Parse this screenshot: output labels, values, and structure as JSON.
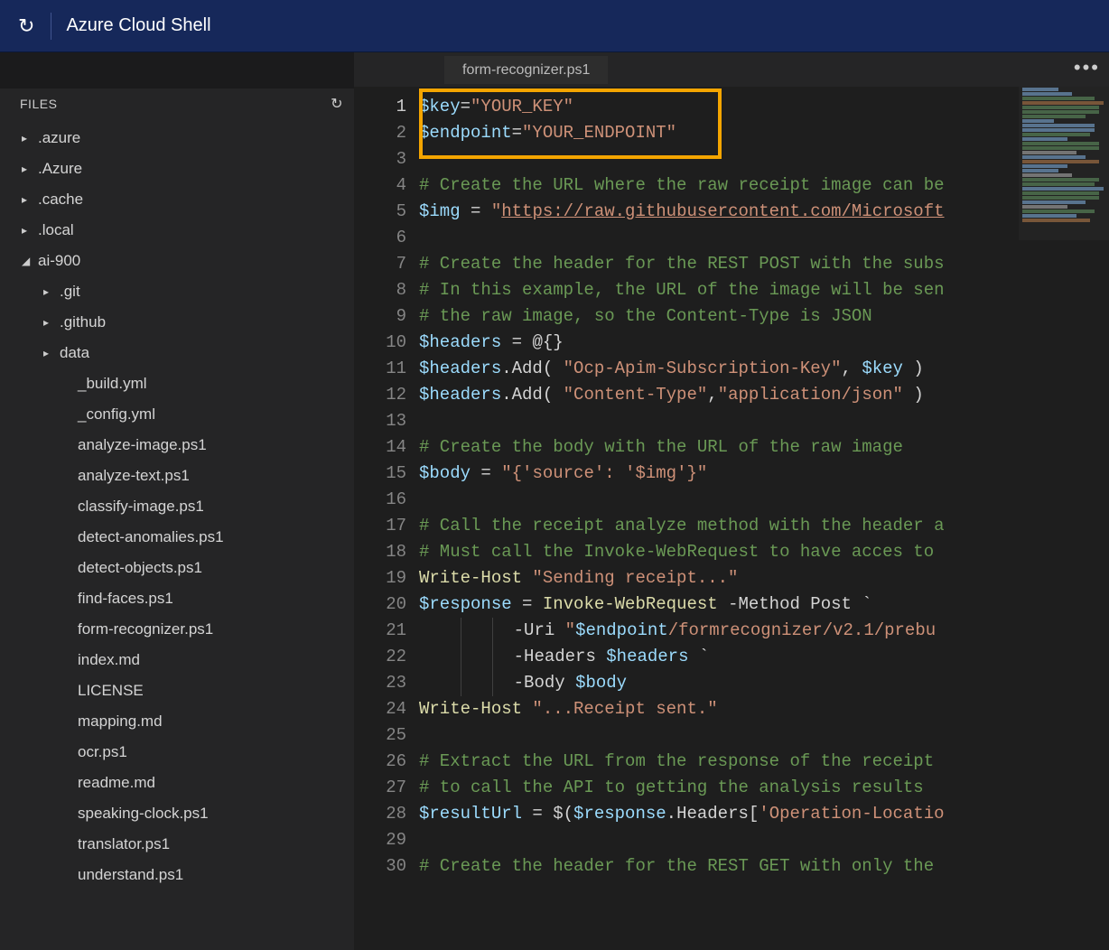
{
  "titlebar": {
    "title": "Azure Cloud Shell"
  },
  "sidebar": {
    "header": "FILES",
    "tree": [
      {
        "level": 1,
        "expand": "closed",
        "label": ".azure"
      },
      {
        "level": 1,
        "expand": "closed",
        "label": ".Azure"
      },
      {
        "level": 1,
        "expand": "closed",
        "label": ".cache"
      },
      {
        "level": 1,
        "expand": "closed",
        "label": ".local"
      },
      {
        "level": 1,
        "expand": "open",
        "label": "ai-900"
      },
      {
        "level": 2,
        "expand": "closed",
        "label": ".git"
      },
      {
        "level": 2,
        "expand": "closed",
        "label": ".github"
      },
      {
        "level": 2,
        "expand": "closed",
        "label": "data"
      },
      {
        "level": 3,
        "expand": "none",
        "label": "_build.yml"
      },
      {
        "level": 3,
        "expand": "none",
        "label": "_config.yml"
      },
      {
        "level": 3,
        "expand": "none",
        "label": "analyze-image.ps1"
      },
      {
        "level": 3,
        "expand": "none",
        "label": "analyze-text.ps1"
      },
      {
        "level": 3,
        "expand": "none",
        "label": "classify-image.ps1"
      },
      {
        "level": 3,
        "expand": "none",
        "label": "detect-anomalies.ps1"
      },
      {
        "level": 3,
        "expand": "none",
        "label": "detect-objects.ps1"
      },
      {
        "level": 3,
        "expand": "none",
        "label": "find-faces.ps1"
      },
      {
        "level": 3,
        "expand": "none",
        "label": "form-recognizer.ps1"
      },
      {
        "level": 3,
        "expand": "none",
        "label": "index.md"
      },
      {
        "level": 3,
        "expand": "none",
        "label": "LICENSE"
      },
      {
        "level": 3,
        "expand": "none",
        "label": "mapping.md"
      },
      {
        "level": 3,
        "expand": "none",
        "label": "ocr.ps1"
      },
      {
        "level": 3,
        "expand": "none",
        "label": "readme.md"
      },
      {
        "level": 3,
        "expand": "none",
        "label": "speaking-clock.ps1"
      },
      {
        "level": 3,
        "expand": "none",
        "label": "translator.ps1"
      },
      {
        "level": 3,
        "expand": "none",
        "label": "understand.ps1"
      }
    ]
  },
  "editor": {
    "tab": "form-recognizer.ps1",
    "lines": [
      {
        "n": 1,
        "t": [
          {
            "c": "var",
            "v": "$key"
          },
          {
            "c": "op",
            "v": "="
          },
          {
            "c": "str",
            "v": "\"YOUR_KEY\""
          }
        ],
        "active": true
      },
      {
        "n": 2,
        "t": [
          {
            "c": "var",
            "v": "$endpoint"
          },
          {
            "c": "op",
            "v": "="
          },
          {
            "c": "str",
            "v": "\"YOUR_ENDPOINT\""
          }
        ]
      },
      {
        "n": 3,
        "t": []
      },
      {
        "n": 4,
        "t": [
          {
            "c": "cmt",
            "v": "# Create the URL where the raw receipt image can be"
          }
        ]
      },
      {
        "n": 5,
        "t": [
          {
            "c": "var",
            "v": "$img"
          },
          {
            "c": "op",
            "v": " = "
          },
          {
            "c": "str",
            "v": "\""
          },
          {
            "c": "url",
            "v": "https://raw.githubusercontent.com/Microsoft"
          }
        ]
      },
      {
        "n": 6,
        "t": []
      },
      {
        "n": 7,
        "t": [
          {
            "c": "cmt",
            "v": "# Create the header for the REST POST with the subs"
          }
        ]
      },
      {
        "n": 8,
        "t": [
          {
            "c": "cmt",
            "v": "# In this example, the URL of the image will be sen"
          }
        ]
      },
      {
        "n": 9,
        "t": [
          {
            "c": "cmt",
            "v": "# the raw image, so the Content-Type is JSON"
          }
        ]
      },
      {
        "n": 10,
        "t": [
          {
            "c": "var",
            "v": "$headers"
          },
          {
            "c": "op",
            "v": " = "
          },
          {
            "c": "op",
            "v": "@{}"
          }
        ]
      },
      {
        "n": 11,
        "t": [
          {
            "c": "var",
            "v": "$headers"
          },
          {
            "c": "meth",
            "v": ".Add( "
          },
          {
            "c": "str",
            "v": "\"Ocp-Apim-Subscription-Key\""
          },
          {
            "c": "op",
            "v": ", "
          },
          {
            "c": "var",
            "v": "$key"
          },
          {
            "c": "op",
            "v": " )"
          }
        ]
      },
      {
        "n": 12,
        "t": [
          {
            "c": "var",
            "v": "$headers"
          },
          {
            "c": "meth",
            "v": ".Add( "
          },
          {
            "c": "str",
            "v": "\"Content-Type\""
          },
          {
            "c": "op",
            "v": ","
          },
          {
            "c": "str",
            "v": "\"application/json\""
          },
          {
            "c": "op",
            "v": " )"
          }
        ]
      },
      {
        "n": 13,
        "t": []
      },
      {
        "n": 14,
        "t": [
          {
            "c": "cmt",
            "v": "# Create the body with the URL of the raw image"
          }
        ]
      },
      {
        "n": 15,
        "t": [
          {
            "c": "var",
            "v": "$body"
          },
          {
            "c": "op",
            "v": " = "
          },
          {
            "c": "str",
            "v": "\"{'source': '$img'}\""
          }
        ]
      },
      {
        "n": 16,
        "t": []
      },
      {
        "n": 17,
        "t": [
          {
            "c": "cmt",
            "v": "# Call the receipt analyze method with the header a"
          }
        ]
      },
      {
        "n": 18,
        "t": [
          {
            "c": "cmt",
            "v": "# Must call the Invoke-WebRequest to have acces to "
          }
        ]
      },
      {
        "n": 19,
        "t": [
          {
            "c": "cmd",
            "v": "Write-Host "
          },
          {
            "c": "str",
            "v": "\"Sending receipt...\""
          }
        ]
      },
      {
        "n": 20,
        "t": [
          {
            "c": "var",
            "v": "$response"
          },
          {
            "c": "op",
            "v": " = "
          },
          {
            "c": "cmd",
            "v": "Invoke-WebRequest "
          },
          {
            "c": "op",
            "v": "-Method Post `"
          }
        ]
      },
      {
        "n": 21,
        "t": [
          {
            "c": "guide",
            "v": "          "
          },
          {
            "c": "op",
            "v": "-Uri "
          },
          {
            "c": "str",
            "v": "\""
          },
          {
            "c": "var",
            "v": "$endpoint"
          },
          {
            "c": "str",
            "v": "/formrecognizer/v2.1/prebu"
          }
        ]
      },
      {
        "n": 22,
        "t": [
          {
            "c": "guide",
            "v": "          "
          },
          {
            "c": "op",
            "v": "-Headers "
          },
          {
            "c": "var",
            "v": "$headers"
          },
          {
            "c": "op",
            "v": " `"
          }
        ]
      },
      {
        "n": 23,
        "t": [
          {
            "c": "guide",
            "v": "          "
          },
          {
            "c": "op",
            "v": "-Body "
          },
          {
            "c": "var",
            "v": "$body"
          }
        ]
      },
      {
        "n": 24,
        "t": [
          {
            "c": "cmd",
            "v": "Write-Host "
          },
          {
            "c": "str",
            "v": "\"...Receipt sent.\""
          }
        ]
      },
      {
        "n": 25,
        "t": []
      },
      {
        "n": 26,
        "t": [
          {
            "c": "cmt",
            "v": "# Extract the URL from the response of the receipt "
          }
        ]
      },
      {
        "n": 27,
        "t": [
          {
            "c": "cmt",
            "v": "# to call the API to getting the analysis results"
          }
        ]
      },
      {
        "n": 28,
        "t": [
          {
            "c": "var",
            "v": "$resultUrl"
          },
          {
            "c": "op",
            "v": " = $("
          },
          {
            "c": "var",
            "v": "$response"
          },
          {
            "c": "meth",
            "v": ".Headers["
          },
          {
            "c": "str",
            "v": "'Operation-Locatio"
          }
        ]
      },
      {
        "n": 29,
        "t": []
      },
      {
        "n": 30,
        "t": [
          {
            "c": "cmt",
            "v": "# Create the header for the REST GET with only the "
          }
        ]
      }
    ]
  }
}
